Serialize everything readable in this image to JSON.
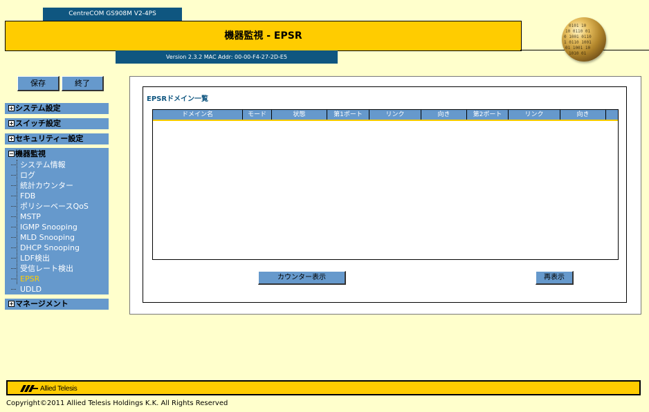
{
  "header": {
    "model": "CentreCOM GS908M V2-4PS",
    "title": "機器監視 - EPSR",
    "version": "Version 2.3.2 MAC Addr: 00-00-F4-27-2D-E5"
  },
  "sidebar": {
    "save_label": "保存",
    "exit_label": "終了",
    "menus": [
      {
        "label": "システム設定",
        "expanded": false
      },
      {
        "label": "スイッチ設定",
        "expanded": false
      },
      {
        "label": "セキュリティー設定",
        "expanded": false
      },
      {
        "label": "機器監視",
        "expanded": true
      },
      {
        "label": "マネージメント",
        "expanded": false
      }
    ],
    "monitor_items": [
      "システム情報",
      "ログ",
      "統計カウンター",
      "FDB",
      "ポリシーベースQoS",
      "MSTP",
      "IGMP Snooping",
      "MLD Snooping",
      "DHCP Snooping",
      "LDF検出",
      "受信レート検出",
      "EPSR",
      "UDLD"
    ],
    "active_item": "EPSR"
  },
  "main": {
    "section_title": "EPSRドメイン一覧",
    "columns": [
      "ドメイン名",
      "モード",
      "状態",
      "第1ポート",
      "リンク",
      "向き",
      "第2ポート",
      "リンク",
      "向き"
    ],
    "rows": [],
    "counter_button": "カウンター表示",
    "refresh_button": "再表示"
  },
  "footer": {
    "logo_text": "Allied Telesis",
    "copyright": "Copyright©2011 Allied Telesis Holdings K.K. All Rights Reserved"
  },
  "colors": {
    "background": "#ffffcc",
    "accent_yellow": "#ffcc00",
    "nav_blue": "#6699cc",
    "dark_blue": "#0f5680",
    "active_item": "#ffcc00"
  },
  "icons": [
    "globe-logo-icon",
    "expand-plus-icon",
    "collapse-minus-icon",
    "allied-telesis-logo-icon"
  ]
}
